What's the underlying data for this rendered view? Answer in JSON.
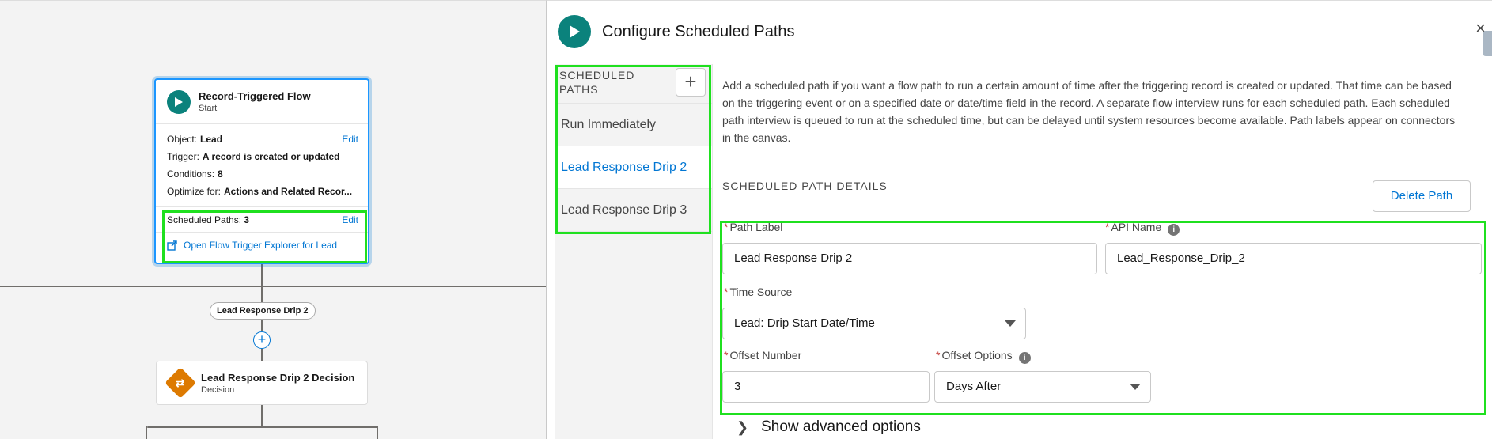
{
  "flow_canvas": {
    "start_card": {
      "title": "Record-Triggered Flow",
      "subtitle": "Start",
      "object_label": "Object:",
      "object_value": "Lead",
      "trigger_label": "Trigger:",
      "trigger_value": "A record is created or updated",
      "conditions_label": "Conditions:",
      "conditions_value": "8",
      "optimize_label": "Optimize for:",
      "optimize_value": "Actions and Related Recor...",
      "edit_label": "Edit",
      "scheduled_paths_label": "Scheduled Paths:",
      "scheduled_paths_value": "3",
      "explorer_link": "Open Flow Trigger Explorer for Lead"
    },
    "connector_label": "Lead Response Drip 2",
    "add_element_symbol": "+",
    "decision_card": {
      "title": "Lead Response Drip 2 Decision",
      "subtitle": "Decision"
    }
  },
  "panel": {
    "title": "Configure Scheduled Paths",
    "close_symbol": "×",
    "path_list": {
      "header": "SCHEDULED PATHS",
      "add_symbol": "+",
      "items": [
        {
          "label": "Run Immediately"
        },
        {
          "label": "Lead Response Drip 2"
        },
        {
          "label": "Lead Response Drip 3"
        }
      ],
      "selected": "Lead Response Drip 2"
    },
    "description": "Add a scheduled path if you want a flow path to run a certain amount of time after the triggering record is created or updated. That time can be based on the triggering event or on a specified date or date/time field in the record. A separate flow interview runs for each scheduled path. Each scheduled path interview is queued to run at the scheduled time, but can be delayed until system resources become available. Path labels appear on connectors in the canvas.",
    "section_title": "SCHEDULED PATH DETAILS",
    "delete_button": "Delete Path",
    "fields": {
      "path_label": {
        "label": "Path Label",
        "value": "Lead Response Drip 2"
      },
      "api_name": {
        "label": "API Name",
        "value": "Lead_Response_Drip_2"
      },
      "time_source": {
        "label": "Time Source",
        "value": "Lead: Drip Start Date/Time"
      },
      "offset_number": {
        "label": "Offset Number",
        "value": "3"
      },
      "offset_options": {
        "label": "Offset Options",
        "value": "Days After"
      }
    },
    "required_marker": "*",
    "info_symbol": "i",
    "advanced_toggle": "Show advanced options",
    "colors": {
      "accent": "#0176d3",
      "start_icon": "#0b827c",
      "decision_icon": "#dd7a01",
      "highlight": "#1fe01f"
    }
  }
}
